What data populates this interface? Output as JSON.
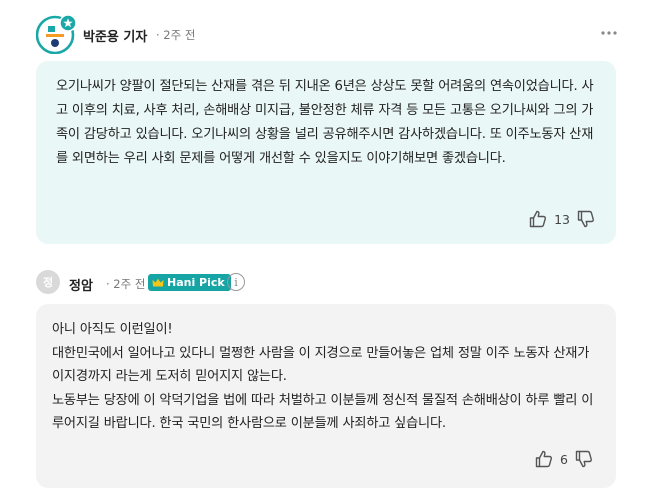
{
  "comment1": {
    "author": "박준용 기자",
    "meta": "· 2주 전",
    "text": "오기나씨가 양팔이 절단되는 산재를 겪은 뒤 지내온 6년은 상상도 못할 어려움의 연속이었습니다. 사고 이후의 치료, 사후 처리, 손해배상 미지급, 불안정한 체류 자격 등 모든 고통은 오기나씨와 그의 가족이 감당하고 있습니다. 오기나씨의 상황을 널리 공유해주시면 감사하겠습니다. 또 이주노동자 산재를 외면하는 우리 사회 문제를 어떻게 개선할 수 있을지도 이야기해보면 좋겠습니다.",
    "likes": "13",
    "avatar_colors": {
      "teal": "#1aa7a7",
      "orange": "#f59a23",
      "navy": "#1f3b73"
    }
  },
  "comment2": {
    "avatar_initial": "정",
    "author": "정암",
    "meta": "· 2주 전",
    "badge": "Hani Pick",
    "info": "i",
    "lines": [
      "아니 아직도 이런일이!",
      "대한민국에서 일어나고 있다니 멀쩡한 사람을 이 지경으로 만들어놓은 업체 정말 이주 노동자 산재가 이지경까지 라는게 도저히 믿어지지 않는다.",
      "노동부는 당장에 이 악덕기업을 법에 따라 처벌하고 이분들께 정신적 물질적 손해배상이 하루 빨리 이루어지길 바랍니다. 한국 국민의 한사람으로 이분들께 사죄하고 싶습니다."
    ],
    "likes": "6"
  },
  "icons": {
    "more": "more-dots-icon",
    "thumbs_up": "thumbs-up-icon",
    "thumbs_down": "thumbs-down-icon",
    "crown": "crown-icon",
    "star": "star-icon"
  },
  "colors": {
    "bubble_reporter": "#eaf7f7",
    "bubble_reader": "#f3f3f3",
    "badge": "#17a4a4"
  }
}
